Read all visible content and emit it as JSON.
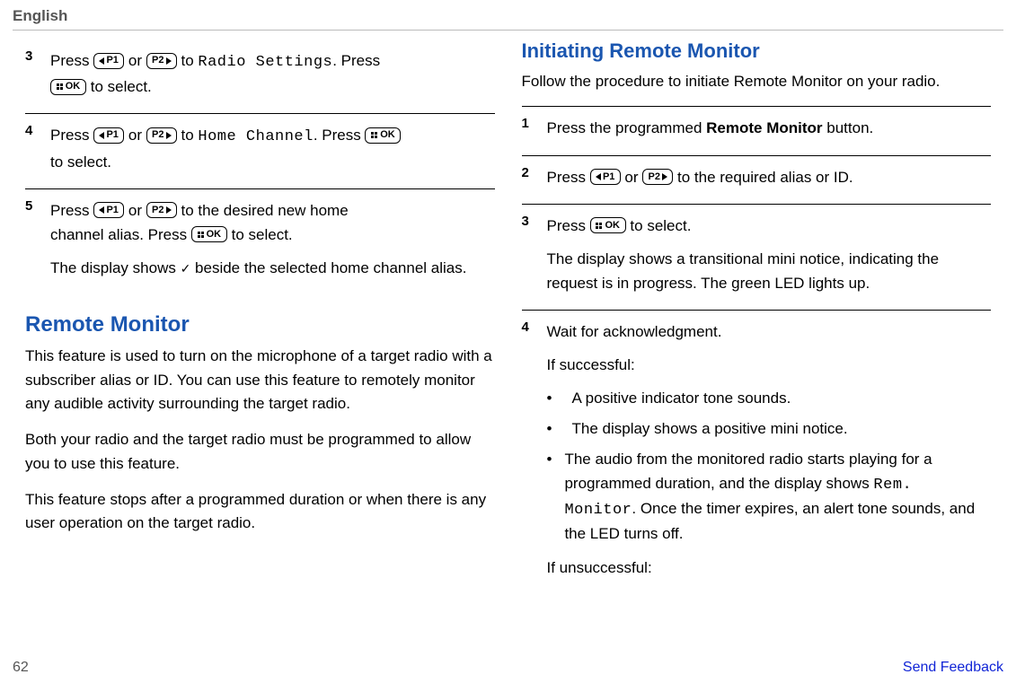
{
  "header": {
    "language": "English"
  },
  "left": {
    "step3": {
      "num": "3",
      "t1": "Press ",
      "t2": " or ",
      "t3": " to ",
      "lcd": "Radio Settings",
      "t4": ". Press ",
      "t5": " to select."
    },
    "step4": {
      "num": "4",
      "t1": "Press ",
      "t2": " or ",
      "t3": " to ",
      "lcd": "Home Channel",
      "t4": ". Press ",
      "t5_pre": "",
      "t5": "to select."
    },
    "step5": {
      "num": "5",
      "p1a": "Press ",
      "p1b": " or ",
      "p1c": " to the desired new home",
      "p1d": "channel alias. Press ",
      "p1e": " to select.",
      "p2a": "The display shows ",
      "p2b": " beside the selected home channel alias."
    },
    "sec_title": "Remote Monitor",
    "para1": "This feature is used to turn on the microphone of a target radio with a subscriber alias or ID. You can use this feature to remotely monitor any audible activity surrounding the target radio.",
    "para2": "Both your radio and the target radio must be programmed to allow you to use this feature.",
    "para3": "This feature stops after a programmed duration or when there is any user operation on the target radio."
  },
  "right": {
    "sec_title": "Initiating Remote Monitor",
    "intro": "Follow the procedure to initiate Remote Monitor on your radio.",
    "step1": {
      "num": "1",
      "t1": "Press the programmed ",
      "bold": "Remote Monitor",
      "t2": " button."
    },
    "step2": {
      "num": "2",
      "t1": "Press ",
      "t2": " or ",
      "t3": " to the required alias or ID."
    },
    "step3": {
      "num": "3",
      "p1a": "Press ",
      "p1b": " to select.",
      "p2": "The display shows a transitional mini notice, indicating the request is in progress. The green LED lights up."
    },
    "step4": {
      "num": "4",
      "p1": "Wait for acknowledgment.",
      "p2": "If successful:",
      "b1": "A positive indicator tone sounds.",
      "b2": "The display shows a positive mini notice.",
      "b3a": "The audio from the monitored radio starts playing for a programmed duration, and the display shows ",
      "b3lcd": "Rem. Monitor",
      "b3b": ". Once the timer expires, an alert tone sounds, and the LED turns off.",
      "p3": "If unsuccessful:"
    }
  },
  "keys": {
    "p1": "P1",
    "p2": "P2",
    "ok": "OK"
  },
  "footer": {
    "page": "62",
    "feedback": "Send Feedback"
  }
}
